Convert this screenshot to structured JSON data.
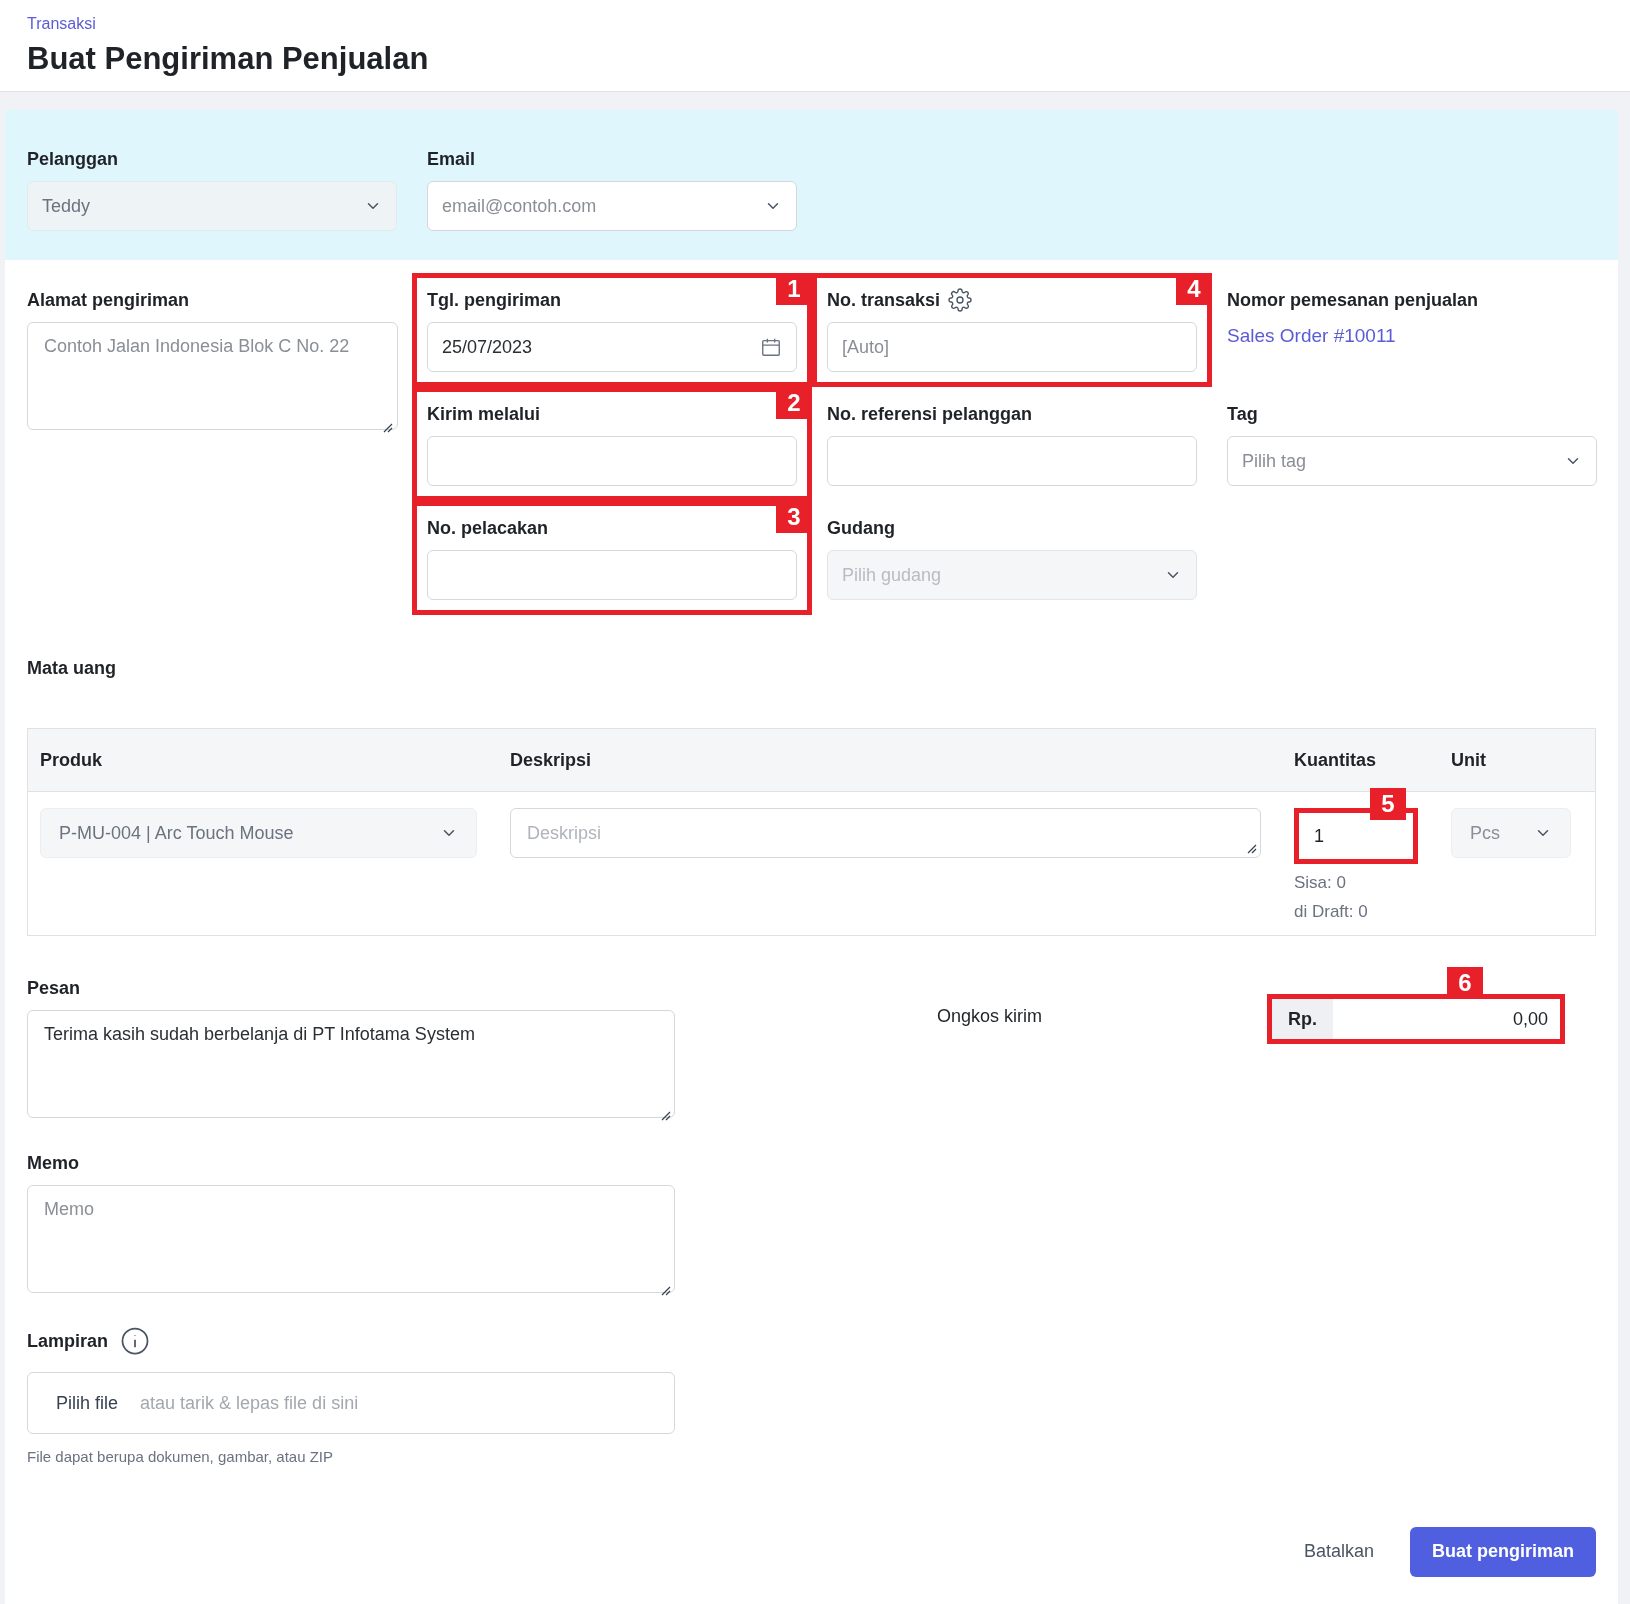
{
  "breadcrumb": "Transaksi",
  "title": "Buat Pengiriman Penjualan",
  "customer": {
    "label": "Pelanggan",
    "value": "Teddy",
    "disabled": true
  },
  "email": {
    "label": "Email",
    "placeholder": "email@contoh.com"
  },
  "address": {
    "label": "Alamat pengiriman",
    "placeholder": "Contoh Jalan Indonesia Blok C No. 22"
  },
  "fields": [
    {
      "label": "Tgl. pengiriman",
      "kind": "date",
      "value": "25/07/2023",
      "callout": "1"
    },
    {
      "label": "No. transaksi",
      "kind": "text",
      "placeholder": "[Auto]",
      "settings": true,
      "callout": "4"
    },
    {
      "label": "Nomor pemesanan penjualan",
      "kind": "link",
      "value": "Sales Order #10011"
    },
    {
      "label": "Kirim melalui",
      "kind": "text",
      "callout": "2"
    },
    {
      "label": "No. referensi pelanggan",
      "kind": "text"
    },
    {
      "label": "Tag",
      "kind": "select",
      "placeholder": "Pilih tag",
      "disabled": false
    },
    {
      "label": "No. pelacakan",
      "kind": "text",
      "callout": "3"
    },
    {
      "label": "Gudang",
      "kind": "select",
      "placeholder": "Pilih gudang",
      "disabled": true
    }
  ],
  "currency_label": "Mata uang",
  "table": {
    "columns": [
      "Produk",
      "Deskripsi",
      "Kuantitas",
      "Unit"
    ],
    "row": {
      "product": "P-MU-004 | Arc Touch Mouse",
      "description_placeholder": "Deskripsi",
      "quantity": "1",
      "quantity_callout": "5",
      "remaining": "Sisa: 0",
      "draft": "di Draft: 0",
      "unit": "Pcs"
    }
  },
  "message": {
    "label": "Pesan",
    "value": "Terima kasih sudah berbelanja di PT Infotama System"
  },
  "shipping": {
    "label": "Ongkos kirim",
    "prefix": "Rp.",
    "value": "0,00",
    "callout": "6"
  },
  "memo": {
    "label": "Memo",
    "placeholder": "Memo"
  },
  "attachment": {
    "label": "Lampiran",
    "button": "Pilih file",
    "placeholder": "atau tarik & lepas file di sini",
    "hint": "File dapat berupa dokumen, gambar, atau ZIP"
  },
  "actions": {
    "cancel": "Batalkan",
    "submit": "Buat pengiriman"
  }
}
